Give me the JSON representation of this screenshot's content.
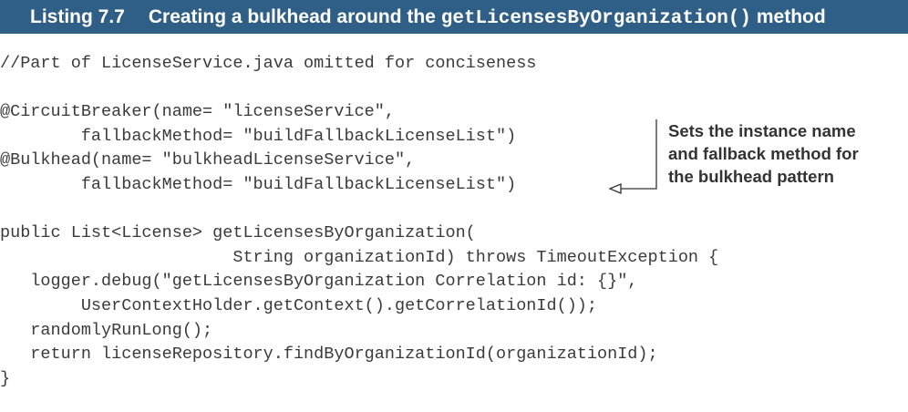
{
  "header": {
    "listing_number": "Listing 7.7",
    "title_prefix": "Creating a bulkhead around the",
    "method_name": "getLicensesByOrganization()",
    "title_suffix": "method"
  },
  "code_lines": [
    "//Part of LicenseService.java omitted for conciseness",
    "",
    "@CircuitBreaker(name= \"licenseService\",",
    "        fallbackMethod= \"buildFallbackLicenseList\")",
    "@Bulkhead(name= \"bulkheadLicenseService\",",
    "        fallbackMethod= \"buildFallbackLicenseList\")",
    "",
    "public List<License> getLicensesByOrganization(",
    "                       String organizationId) throws TimeoutException {",
    "   logger.debug(\"getLicensesByOrganization Correlation id: {}\",",
    "        UserContextHolder.getContext().getCorrelationId());",
    "   randomlyRunLong();",
    "   return licenseRepository.findByOrganizationId(organizationId);",
    "}"
  ],
  "annotation": {
    "lines": [
      "Sets the instance name",
      "and fallback method for",
      "the bulkhead pattern"
    ]
  },
  "colors": {
    "header_bg": "#2f5f86",
    "header_text": "#ffffff",
    "code_text": "#3a3a3a",
    "annotation_text": "#333333"
  }
}
